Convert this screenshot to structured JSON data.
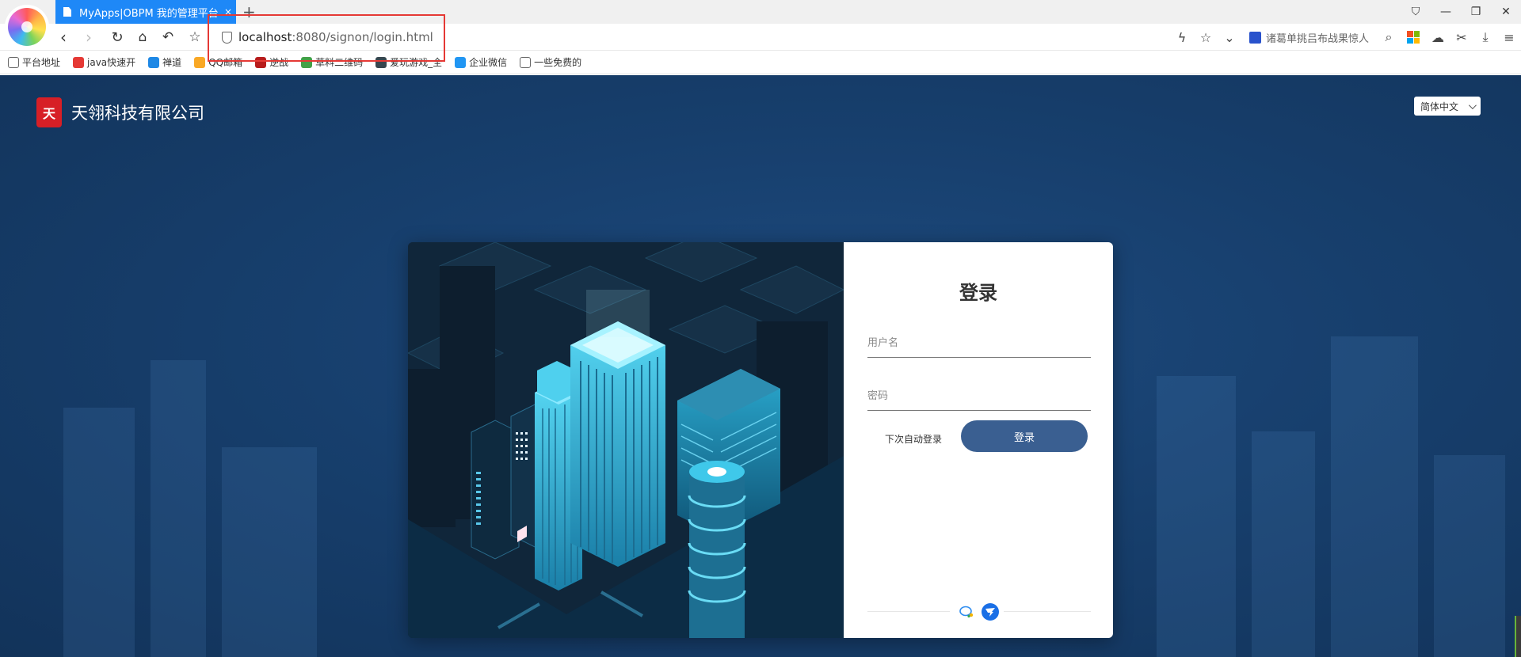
{
  "browser": {
    "tab_title": "MyApps|OBPM 我的管理平台",
    "tab_close": "×",
    "new_tab": "+",
    "url_host": "localhost",
    "url_rest": ":8080/signon/login.html",
    "search_suggestion": "诸葛单挑吕布战果惊人",
    "window_controls": [
      "⛉",
      "—",
      "❐",
      "✕"
    ],
    "bookmarks": [
      {
        "label": "平台地址",
        "color": "#ffffff",
        "icon": "folder-icon"
      },
      {
        "label": "java快速开",
        "color": "#e53935",
        "icon": "java-icon"
      },
      {
        "label": "禅道",
        "color": "#1e88e5",
        "icon": "zentao-icon"
      },
      {
        "label": "QQ邮箱",
        "color": "#f9a825",
        "icon": "qqmail-icon"
      },
      {
        "label": "逆战",
        "color": "#b71c1c",
        "icon": "game-icon"
      },
      {
        "label": "草料二维码",
        "color": "#43a047",
        "icon": "qrcode-icon"
      },
      {
        "label": "爱玩游戏_全",
        "color": "#37474f",
        "icon": "diamond-icon"
      },
      {
        "label": "企业微信",
        "color": "#2196f3",
        "icon": "wework-icon"
      },
      {
        "label": "一些免费的",
        "color": "#ffffff",
        "icon": "user-icon"
      }
    ]
  },
  "page": {
    "company_name": "天翎科技有限公司",
    "logo_text": "天",
    "language": "简体中文"
  },
  "login": {
    "title": "登录",
    "username_placeholder": "用户名",
    "password_placeholder": "密码",
    "remember_label": "下次自动登录",
    "submit_label": "登录"
  },
  "colors": {
    "accent": "#1e88f7",
    "login_button": "#3a5f91",
    "page_bg": "#173f6d",
    "highlight": "#e53935"
  }
}
